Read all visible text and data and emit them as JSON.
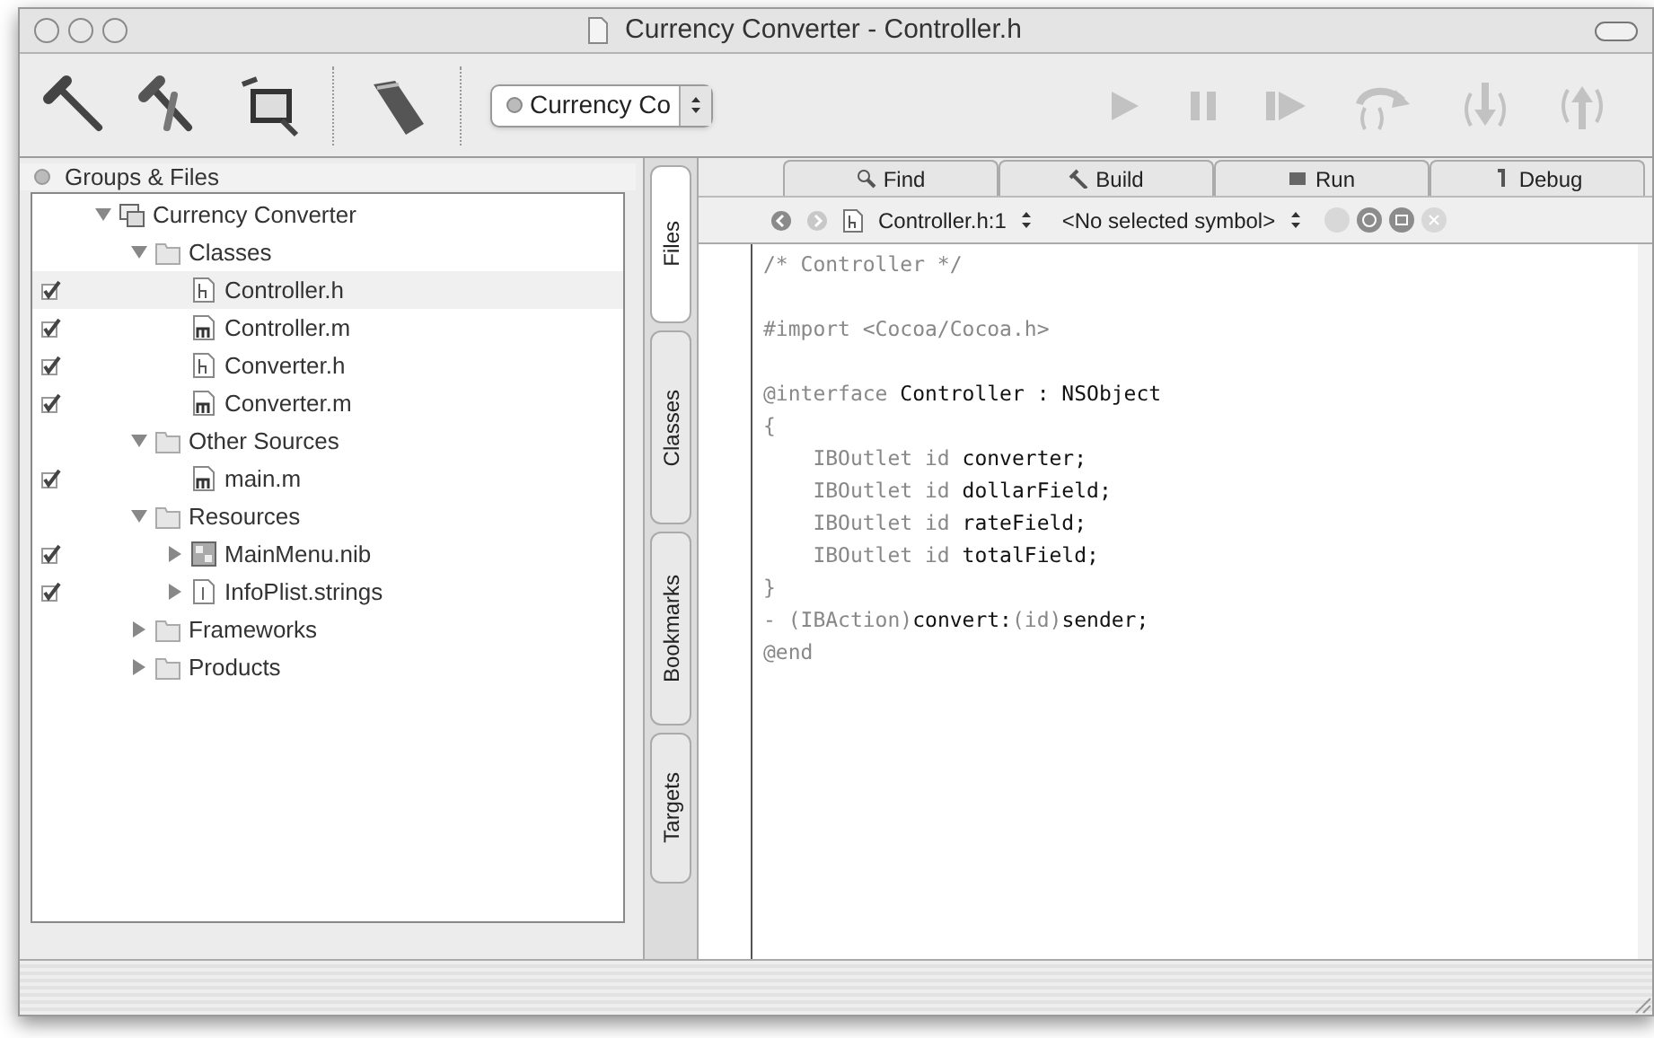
{
  "window": {
    "title": "Currency Converter - Controller.h"
  },
  "toolbar": {
    "target_popup": "Currency Co"
  },
  "groups_header": "Groups & Files",
  "tree": [
    {
      "label": "Currency Converter",
      "kind": "project",
      "expanded": true,
      "selected": false,
      "children": [
        {
          "label": "Classes",
          "kind": "folder",
          "expanded": true,
          "selected": false,
          "children": [
            {
              "label": "Controller.h",
              "kind": "header",
              "checked": true,
              "selected": true
            },
            {
              "label": "Controller.m",
              "kind": "source",
              "checked": true,
              "selected": false
            },
            {
              "label": "Converter.h",
              "kind": "header",
              "checked": true,
              "selected": false
            },
            {
              "label": "Converter.m",
              "kind": "source",
              "checked": true,
              "selected": false
            }
          ]
        },
        {
          "label": "Other Sources",
          "kind": "folder",
          "expanded": true,
          "selected": false,
          "children": [
            {
              "label": "main.m",
              "kind": "source",
              "checked": true,
              "selected": false
            }
          ]
        },
        {
          "label": "Resources",
          "kind": "folder",
          "expanded": true,
          "selected": false,
          "children": [
            {
              "label": "MainMenu.nib",
              "kind": "nib",
              "checked": true,
              "expanded": false,
              "selected": false
            },
            {
              "label": "InfoPlist.strings",
              "kind": "strings",
              "checked": true,
              "expanded": false,
              "selected": false
            }
          ]
        },
        {
          "label": "Frameworks",
          "kind": "folder",
          "expanded": false,
          "selected": false
        },
        {
          "label": "Products",
          "kind": "folder",
          "expanded": false,
          "selected": false
        }
      ]
    }
  ],
  "side_tabs": [
    {
      "label": "Files",
      "selected": true
    },
    {
      "label": "Classes",
      "selected": false
    },
    {
      "label": "Bookmarks",
      "selected": false
    },
    {
      "label": "Targets",
      "selected": false
    }
  ],
  "editor_tabs": [
    {
      "label": "Find",
      "kind": "find"
    },
    {
      "label": "Build",
      "kind": "build"
    },
    {
      "label": "Run",
      "kind": "run"
    },
    {
      "label": "Debug",
      "kind": "debug"
    }
  ],
  "nav_bar": {
    "file_popup": "Controller.h:1",
    "symbol_popup": "<No selected symbol>"
  },
  "code_blocks": [
    [
      "/* Controller */"
    ],
    [
      "#import <Cocoa/Cocoa.h>"
    ],
    [
      "@interface **Controller : NSObject**",
      "{",
      "    IBOutlet id **converter;**",
      "    IBOutlet id **dollarField;**",
      "    IBOutlet id **rateField;**",
      "    IBOutlet id **totalField;**",
      "}",
      "- (IBAction)**convert:**(id)**sender;**",
      "@end"
    ]
  ]
}
